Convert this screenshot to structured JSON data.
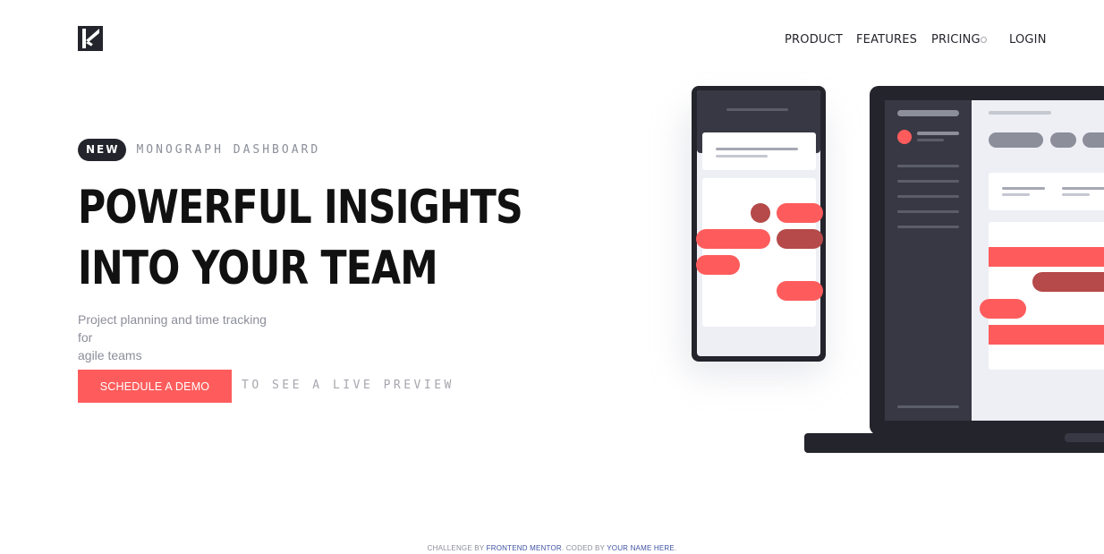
{
  "nav": {
    "product": "PRODUCT",
    "features": "FEATURES",
    "pricing": "PRICING",
    "login": "LOGIN"
  },
  "hero": {
    "badge": "NEW",
    "badge_text": "MONOGRAPH DASHBOARD",
    "headline_line1": "POWERFUL INSIGHTS",
    "headline_line2": "INTO YOUR TEAM",
    "subtitle_line1": "Project planning and time tracking for",
    "subtitle_line2": "agile teams",
    "cta_label": "SCHEDULE A DEMO",
    "cta_note": "TO SEE A LIVE PREVIEW"
  },
  "footer": {
    "prefix": "CHALLENGE BY ",
    "challenge_link": "FRONTEND MENTOR",
    "middle": ". CODED BY ",
    "author_link": "YOUR NAME HERE",
    "suffix": "."
  },
  "colors": {
    "accent": "#fe5c5c",
    "accent_dark": "#b64949",
    "dark": "#24242c",
    "muted": "#8c8e9a"
  }
}
